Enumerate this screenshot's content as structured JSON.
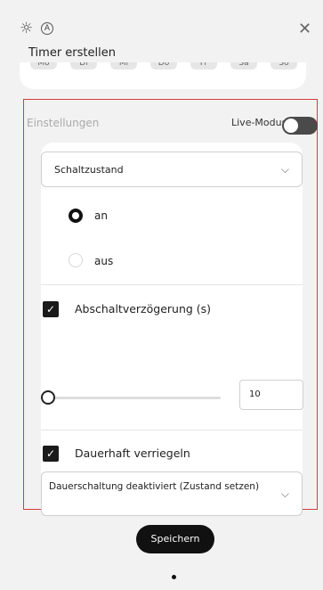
{
  "header": {
    "sun_icon": "sun-icon",
    "auto_icon": "auto-mode-icon",
    "auto_glyph": "A",
    "close_icon": "close-icon",
    "title": "Timer erstellen"
  },
  "weekdays": [
    "Mo",
    "Di",
    "Mi",
    "Do",
    "Fr",
    "Sa",
    "So"
  ],
  "settings": {
    "section_label": "Einstellungen",
    "live_mode_label": "Live-Modus",
    "live_mode_on": false,
    "state_select": {
      "value": "Schaltzustand"
    },
    "state_options": [
      {
        "label": "an",
        "selected": true
      },
      {
        "label": "aus",
        "selected": false
      }
    ],
    "off_delay": {
      "checked": true,
      "label": "Abschaltverzögerung (s)",
      "slider_fraction": 0.0,
      "value": "10"
    },
    "permanent_lock": {
      "checked": true,
      "label": "Dauerhaft verriegeln"
    },
    "lock_select": {
      "value": "Dauerschaltung deaktiviert (Zustand setzen)"
    }
  },
  "footer": {
    "save_label": "Speichern"
  },
  "colors": {
    "highlight_border": "#d33c3f",
    "button_bg": "#111111",
    "toggle_bg": "#4a4a4a"
  }
}
